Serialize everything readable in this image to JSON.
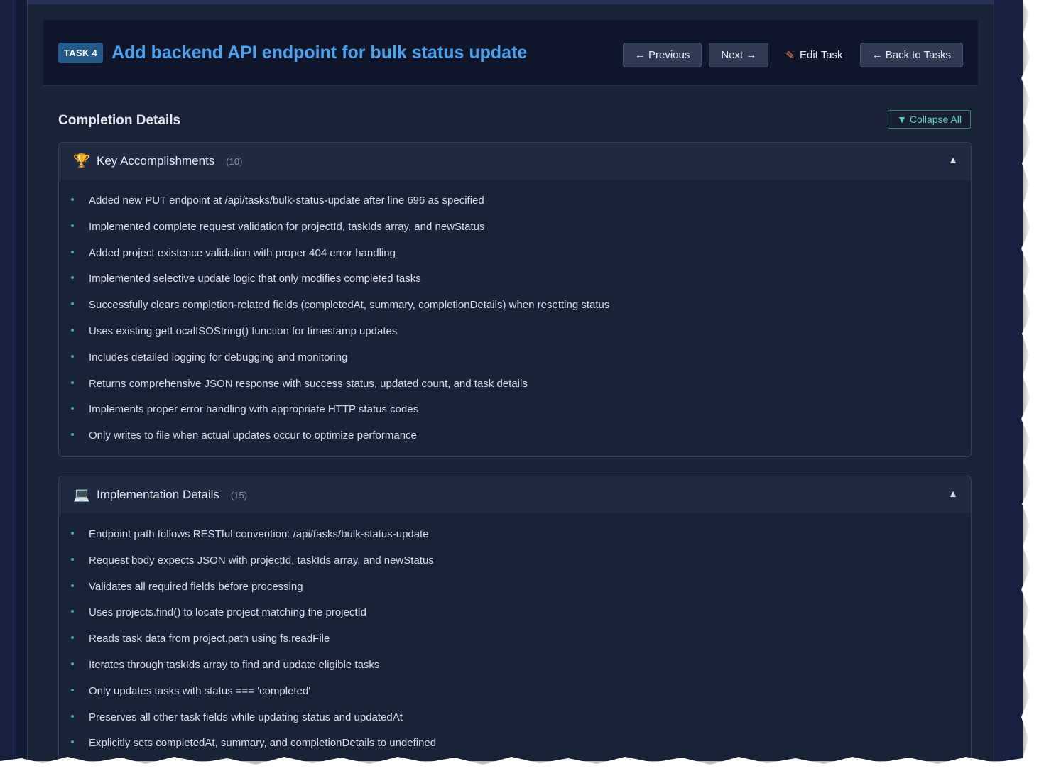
{
  "header": {
    "badge": "TASK 4",
    "title": "Add backend API endpoint for bulk status update",
    "buttons": {
      "previous": "← Previous",
      "next": "Next →",
      "edit": "Edit Task",
      "back": "← Back to Tasks"
    },
    "edit_icon": "pencil-icon"
  },
  "completion": {
    "title": "Completion Details",
    "collapse_label": "▼ Collapse All"
  },
  "cards": [
    {
      "icon": "trophy-icon",
      "icon_glyph": "🏆",
      "title": "Key Accomplishments",
      "count": "(10)",
      "toggle": "▲",
      "items": [
        "Added new PUT endpoint at /api/tasks/bulk-status-update after line 696 as specified",
        "Implemented complete request validation for projectId, taskIds array, and newStatus",
        "Added project existence validation with proper 404 error handling",
        "Implemented selective update logic that only modifies completed tasks",
        "Successfully clears completion-related fields (completedAt, summary, completionDetails) when resetting status",
        "Uses existing getLocalISOString() function for timestamp updates",
        "Includes detailed logging for debugging and monitoring",
        "Returns comprehensive JSON response with success status, updated count, and task details",
        "Implements proper error handling with appropriate HTTP status codes",
        "Only writes to file when actual updates occur to optimize performance"
      ]
    },
    {
      "icon": "laptop-icon",
      "icon_glyph": "💻",
      "title": "Implementation Details",
      "count": "(15)",
      "toggle": "▲",
      "items": [
        "Endpoint path follows RESTful convention: /api/tasks/bulk-status-update",
        "Request body expects JSON with projectId, taskIds array, and newStatus",
        "Validates all required fields before processing",
        "Uses projects.find() to locate project matching the projectId",
        "Reads task data from project.path using fs.readFile",
        "Iterates through taskIds array to find and update eligible tasks",
        "Only updates tasks with status === 'completed'",
        "Preserves all other task fields while updating status and updatedAt",
        "Explicitly sets completedAt, summary, and completionDetails to undefined"
      ]
    }
  ],
  "colors": {
    "title_blue": "#4aa3f0",
    "badge_bg": "#245a8a",
    "accent_teal": "#5fd1bb",
    "bullet": "#4cae9a",
    "panel_bg": "#1a2236",
    "header_bg": "#0f1629"
  }
}
